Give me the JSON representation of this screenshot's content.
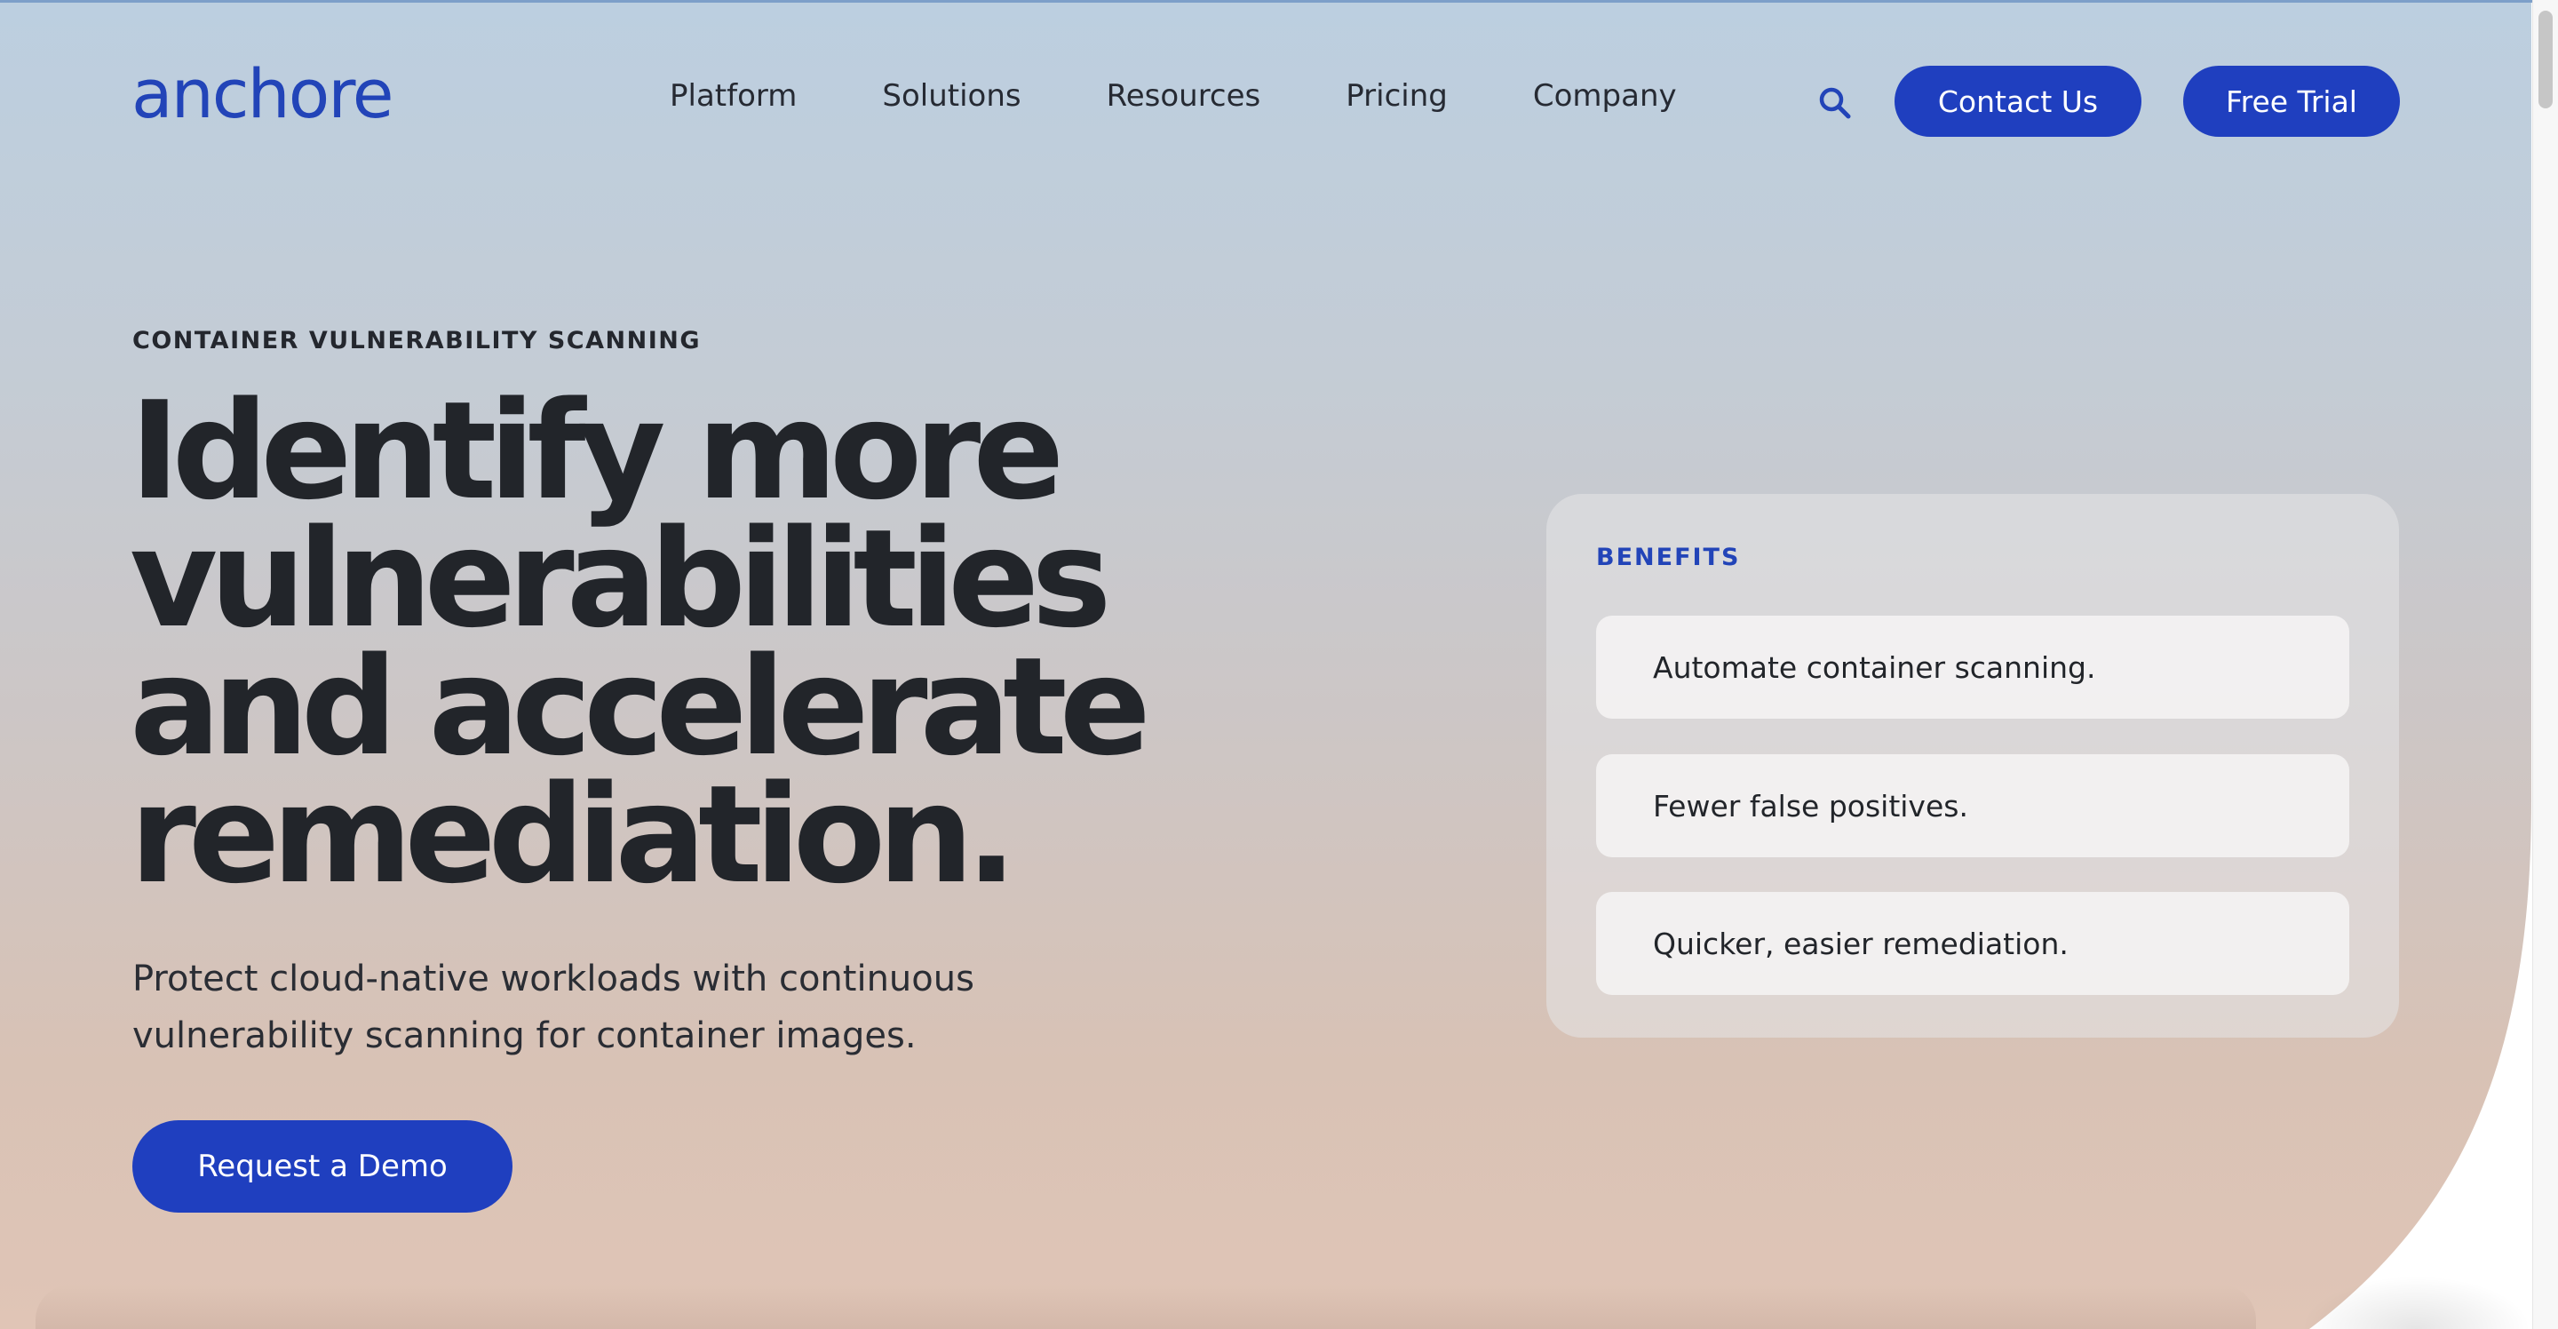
{
  "header": {
    "logo_text": "anchore",
    "nav_items": [
      {
        "label": "Platform"
      },
      {
        "label": "Solutions"
      },
      {
        "label": "Resources"
      },
      {
        "label": "Pricing"
      },
      {
        "label": "Company"
      }
    ],
    "search_icon": "search-icon",
    "contact_label": "Contact Us",
    "trial_label": "Free Trial"
  },
  "hero": {
    "eyebrow": "CONTAINER VULNERABILITY SCANNING",
    "headline_lines": [
      "Identify more",
      "vulnerabilities",
      "and accelerate",
      "remediation."
    ],
    "subtext_lines": [
      "Protect cloud-native workloads with continuous",
      "vulnerability scanning for container images."
    ],
    "cta_label": "Request a Demo"
  },
  "benefits": {
    "title": "BENEFITS",
    "items": [
      "Automate container scanning.",
      "Fewer false positives.",
      "Quicker, easier remediation."
    ]
  },
  "colors": {
    "brand_blue": "#1f3fbf",
    "text_dark": "#22252a"
  }
}
